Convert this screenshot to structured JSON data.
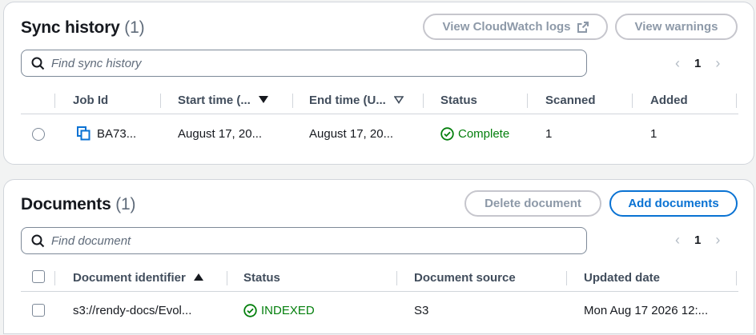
{
  "sync_history": {
    "title": "Sync history",
    "count": "(1)",
    "buttons": {
      "cloudwatch": "View CloudWatch logs",
      "warnings": "View warnings"
    },
    "search_placeholder": "Find sync history",
    "page": "1",
    "columns": [
      "Job Id",
      "Start time (...",
      "End time (U...",
      "Status",
      "Scanned",
      "Added"
    ],
    "row": {
      "job_id": "BA73...",
      "start_time": "August 17, 20...",
      "end_time": "August 17, 20...",
      "status": "Complete",
      "scanned": "1",
      "added": "1"
    }
  },
  "documents": {
    "title": "Documents",
    "count": "(1)",
    "buttons": {
      "delete": "Delete document",
      "add": "Add documents"
    },
    "search_placeholder": "Find document",
    "page": "1",
    "columns": [
      "Document identifier",
      "Status",
      "Document source",
      "Updated date"
    ],
    "row": {
      "identifier": "s3://rendy-docs/Evol...",
      "status": "INDEXED",
      "source": "S3",
      "updated": "Mon Aug 17 2026 12:..."
    }
  },
  "colors": {
    "accent": "#0972d3",
    "success": "#037f0c",
    "disabled": "#8d99a8"
  }
}
